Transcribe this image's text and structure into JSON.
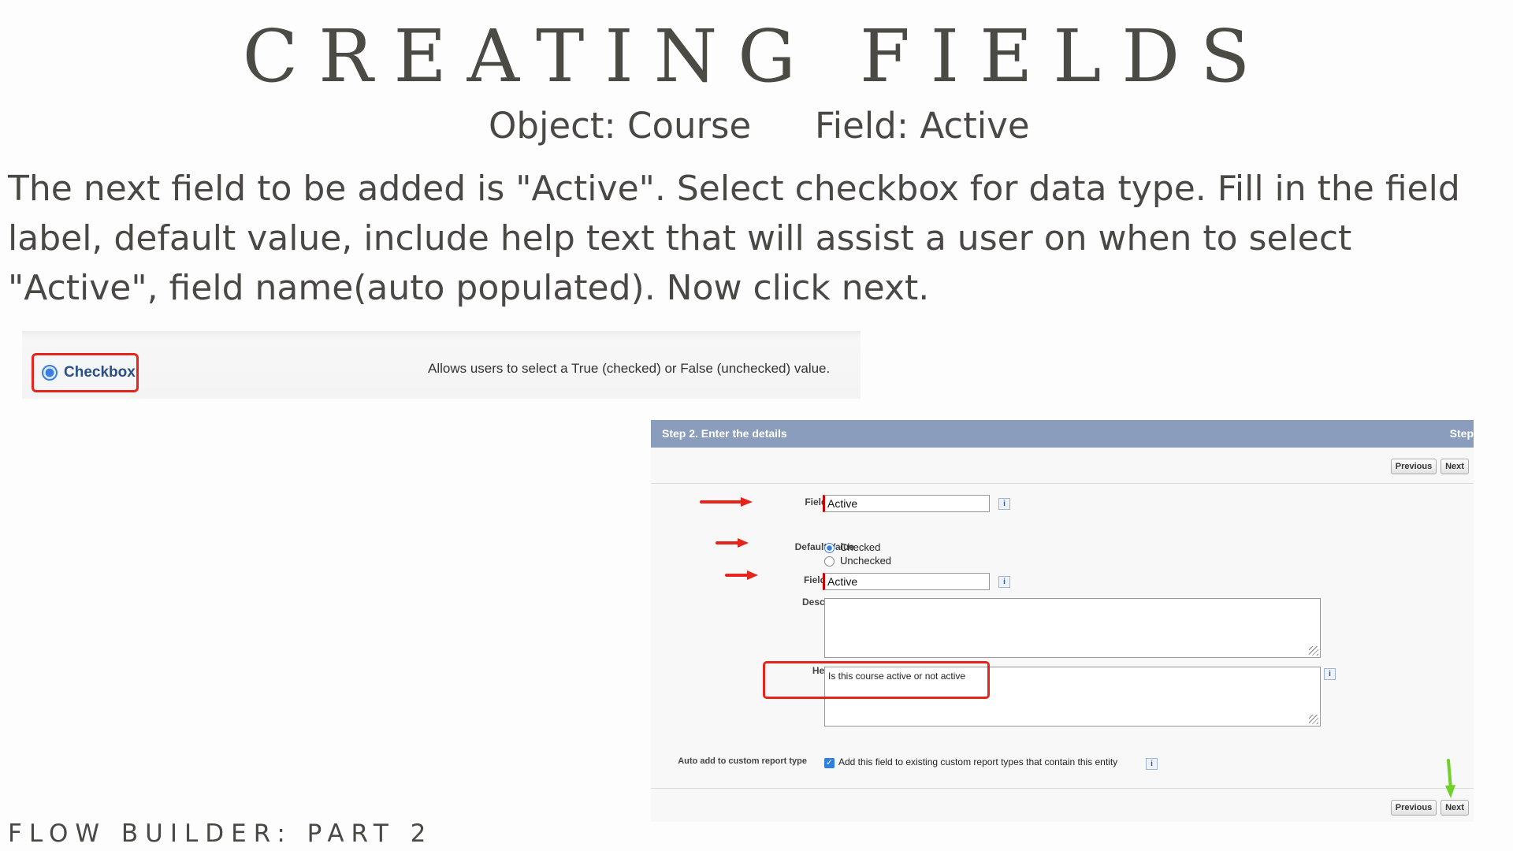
{
  "slide": {
    "title": "CREATING FIELDS",
    "object_label": "Object: Course",
    "field_label": "Field: Active",
    "instructions": "The next field to be added is \"Active\". Select checkbox for data type. Fill in the field label, default value, include help text that will assist a user on when to select \"Active\", field name(auto populated). Now click next.",
    "footer": "FLOW BUILDER: PART 2"
  },
  "data_type": {
    "option_label": "Checkbox",
    "option_description": "Allows users to select a True (checked) or False (unchecked) value."
  },
  "form": {
    "header_title": "Step 2. Enter the details",
    "header_right": "Step",
    "previous_label": "Previous",
    "next_label": "Next",
    "field_label": {
      "label": "Field Label",
      "value": "Active"
    },
    "default_value": {
      "label": "Default Value",
      "options": [
        "Checked",
        "Unchecked"
      ],
      "selected": "Checked"
    },
    "field_name": {
      "label": "Field Name",
      "value": "Active"
    },
    "description": {
      "label": "Description",
      "value": ""
    },
    "help_text": {
      "label": "Help Text",
      "value": "Is this course active or not active"
    },
    "auto_add": {
      "label": "Auto add to custom report type",
      "checkbox_text": "Add this field to existing custom report types that contain this entity",
      "checked": true
    },
    "info_icon_glyph": "i"
  },
  "colors": {
    "highlight_red": "#e5251c",
    "arrow_green": "#6fd12a",
    "header_blue": "#8a9dbd",
    "text_gray": "#4a4844"
  }
}
